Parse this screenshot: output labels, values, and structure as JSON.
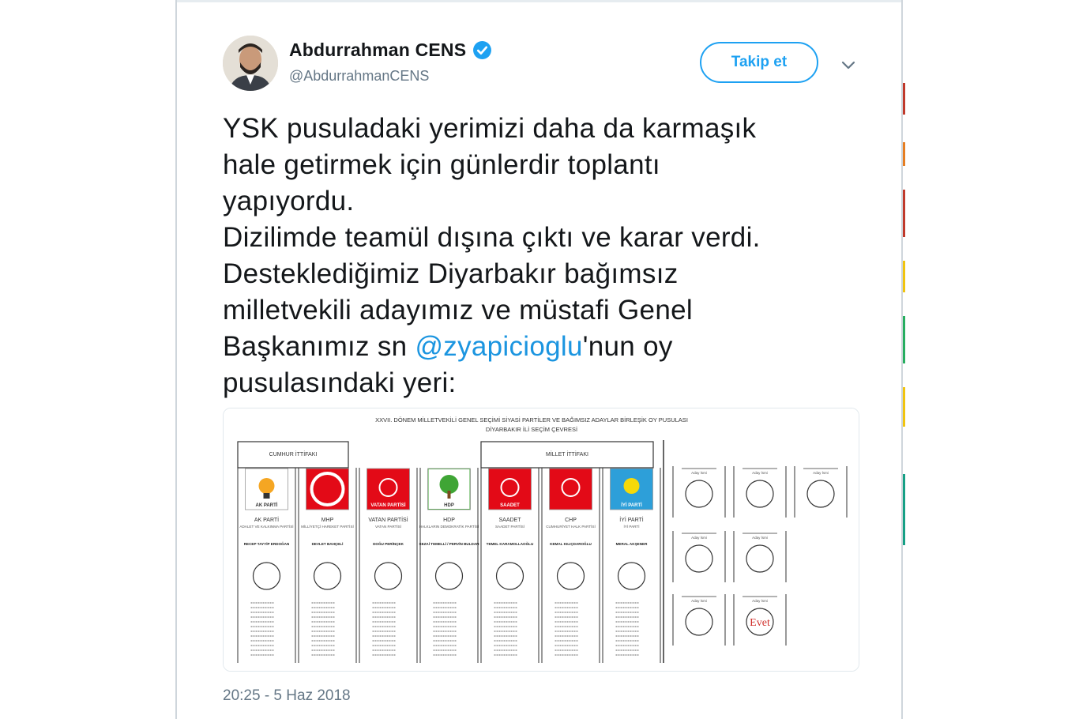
{
  "user": {
    "display_name": "Abdurrahman CENS",
    "handle": "@AbdurrahmanCENS",
    "verified": true
  },
  "actions": {
    "follow_label": "Takip et",
    "menu_icon": "chevron-down-icon"
  },
  "tweet": {
    "lines": [
      "YSK pusuladaki yerimizi daha da karmaşık",
      "hale getirmek için günlerdir toplantı",
      "yapıyordu.",
      "Dizilimde teamül dışına çıktı ve karar verdi.",
      "Desteklediğimiz Diyarbakır bağımsız",
      "milletvekili adayımız ve müstafi Genel"
    ],
    "line7_prefix": "Başkanımız sn ",
    "mention": "@zyapicioglu",
    "line7_suffix": "'nun oy",
    "line8": "pusulasındaki yeri:"
  },
  "ballot": {
    "title": "XXVII. DÖNEM MİLLETVEKİLİ GENEL SEÇİMİ SİYASİ PARTİLER VE BAĞIMSIZ ADAYLAR BİRLEŞİK OY PUSULASI",
    "subtitle": "DİYARBAKIR İLİ SEÇİM ÇEVRESİ",
    "alliance_left": "CUMHUR İTTİFAKI",
    "alliance_right": "MİLLET İTTİFAKI",
    "parties": [
      {
        "logo_text": "AK PARTİ",
        "name": "AK PARTİ",
        "full": "ADALET VE KALKINMA PARTİSİ",
        "leader": "RECEP TAYYİP ERDOĞAN",
        "color": "#f5a623"
      },
      {
        "logo_text": "",
        "name": "MHP",
        "full": "MİLLİYETÇİ HAREKET PARTİSİ",
        "leader": "DEVLET BAHÇELİ",
        "color": "#e30a17"
      },
      {
        "logo_text": "VATAN PARTİSİ",
        "name": "VATAN PARTİSİ",
        "full": "VATAN PARTİSİ",
        "leader": "DOĞU PERİNÇEK",
        "color": "#e30a17"
      },
      {
        "logo_text": "HDP",
        "name": "HDP",
        "full": "HALKLARIN DEMOKRATİK PARTİSİ",
        "leader": "SEZAİ TEMELLİ / PERVİN BULDAN",
        "color": "#3fa535"
      },
      {
        "logo_text": "SAADET",
        "name": "SAADET",
        "full": "SAADET PARTİSİ",
        "leader": "TEMEL KARAMOLLAOĞLU",
        "color": "#e30a17"
      },
      {
        "logo_text": "",
        "name": "CHP",
        "full": "CUMHURİYET HALK PARTİSİ",
        "leader": "KEMAL KILIÇDAROĞLU",
        "color": "#e30a17"
      },
      {
        "logo_text": "İYİ PARTİ",
        "name": "İYİ PARTİ",
        "full": "İYİ PARTİ",
        "leader": "MERAL AKŞENER",
        "color": "#2d9fd9"
      }
    ],
    "independent_label": "Aday İsmi",
    "evet_label": "Evet"
  },
  "timestamp": "20:25 - 5 Haz 2018",
  "colors": {
    "twitter_blue": "#1da1f2",
    "mention_blue": "#1b95e0",
    "text_dark": "#14171a",
    "text_gray": "#657786"
  }
}
